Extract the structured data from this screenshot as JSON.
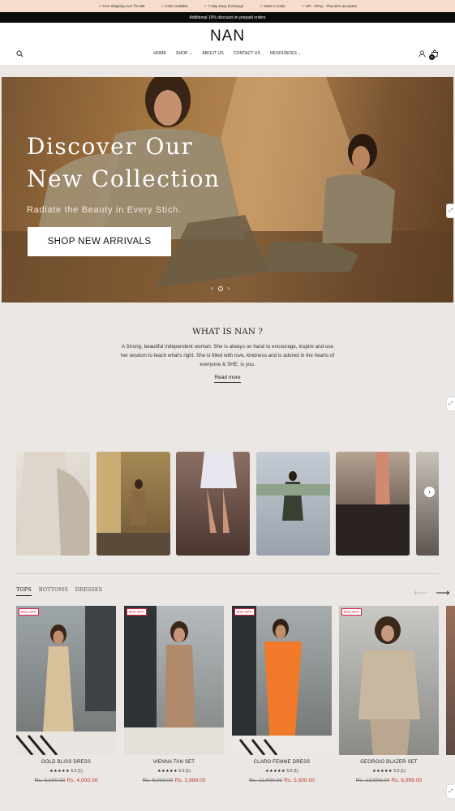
{
  "topbar": {
    "items": [
      "✓ Free Shipping over ₹2,499",
      "✓ COD Available",
      "✓ 7-Day Easy Exchange",
      "✓ Made in India",
      "✓ UPI · GPay · PhonePe accepted"
    ]
  },
  "announcement": "Additional 10% discount on prepaid orders",
  "header": {
    "logo": "NAN",
    "nav": [
      "HOME",
      "SHOP ⌄",
      "ABOUT US",
      "CONTACT US",
      "RESOURCES ⌄"
    ],
    "cart_count": "0"
  },
  "hero": {
    "title_line1": "Discover Our",
    "title_line2": "New Collection",
    "subtitle": "Radiate the Beauty in Every Stich.",
    "button": "SHOP NEW ARRIVALS",
    "prev": "‹",
    "next": "›"
  },
  "about": {
    "title": "WHAT IS NAN ?",
    "text": "A Strong, beautiful independent woman. She is always on hand to encourage, inspire and use her wisdom to teach what's right. She is filled with love, kindness and is adored in the hearts of everyone & SHE, is you.",
    "read_more": "Read more"
  },
  "reels": {
    "next": "›"
  },
  "tabs": [
    "TOPS",
    "BOTTOMS",
    "DRESSES"
  ],
  "carousel_arrows": {
    "prev": "⟵",
    "next": "⟶"
  },
  "products": [
    {
      "badge": "50% OFF",
      "name": "GOLD BLISS DRESS",
      "stars": "★★★★★",
      "rating": "5.0 (1)",
      "old_price": "Rs. 8,000.00",
      "price": "Rs. 4,000.00",
      "color": "#d8c09a"
    },
    {
      "badge": "50% OFF",
      "name": "VIENNA TAN SET",
      "stars": "★★★★★",
      "rating": "5.0 (1)",
      "old_price": "Rs. 8,000.00",
      "price": "Rs. 3,999.00",
      "color": "#b08a6a"
    },
    {
      "badge": "50% OFF",
      "name": "CLARO FEMME DRESS",
      "stars": "★★★★★",
      "rating": "5.0 (1)",
      "old_price": "Rs. 11,000.00",
      "price": "Rs. 5,500.00",
      "color": "#f07a2a"
    },
    {
      "badge": "50% OFF",
      "name": "GEORGIO BLAZER SET",
      "stars": "★★★★★",
      "rating": "5.0 (1)",
      "old_price": "Rs. 13,999.00",
      "price": "Rs. 6,999.00",
      "color": "#c8b8a0"
    }
  ]
}
